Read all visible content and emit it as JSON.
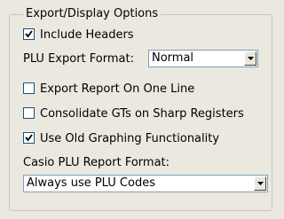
{
  "group": {
    "title": "Export/Display Options"
  },
  "options": {
    "include_headers": {
      "label": "Include Headers",
      "checked": true
    },
    "export_one_line": {
      "label": "Export Report On One Line",
      "checked": false
    },
    "consolidate_gts": {
      "label": "Consolidate GTs on Sharp Registers",
      "checked": false
    },
    "old_graphing": {
      "label": "Use Old Graphing Functionality",
      "checked": true
    }
  },
  "plu_export": {
    "label": "PLU Export Format:",
    "selected": "Normal"
  },
  "casio_plu": {
    "label": "Casio PLU Report Format:",
    "selected": "Always use PLU Codes"
  },
  "icons": {
    "checkmark": "checkmark-icon",
    "dropdown": "chevron-down-icon"
  },
  "colors": {
    "background": "#ebe9df",
    "group_border": "#c9c6b8",
    "checkbox_border": "#1c5180",
    "select_border": "#7f9db9"
  }
}
